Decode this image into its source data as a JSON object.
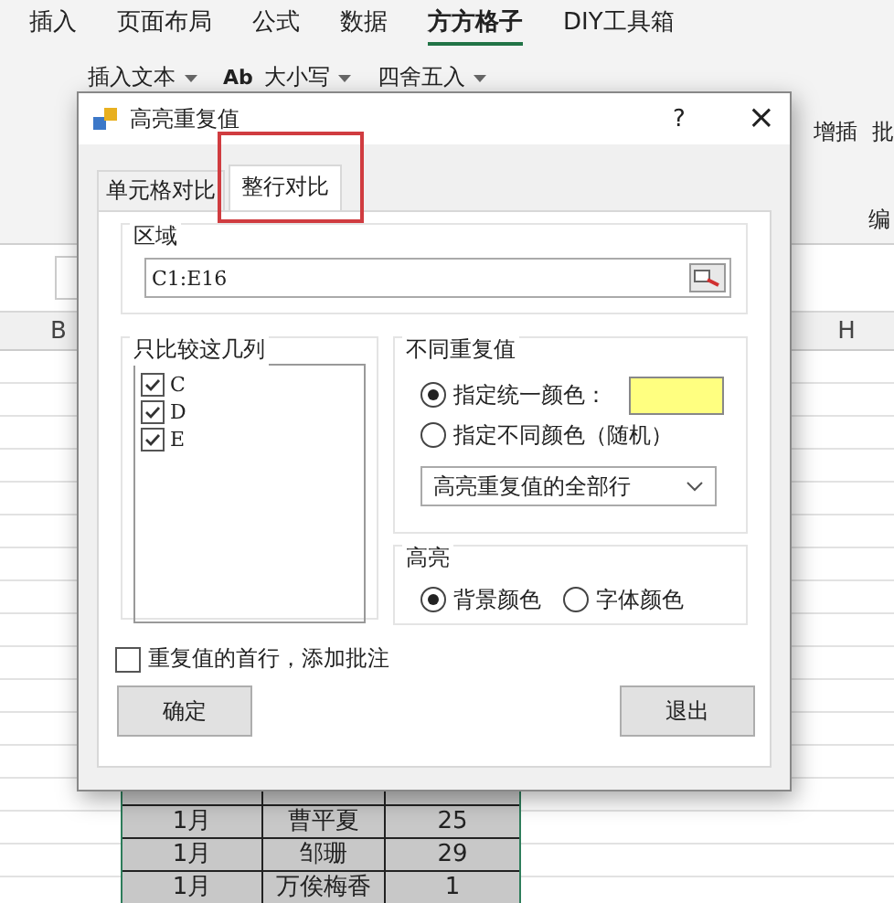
{
  "ribbon_tabs": [
    {
      "label": "插入",
      "selected": false
    },
    {
      "label": "页面布局",
      "selected": false
    },
    {
      "label": "公式",
      "selected": false
    },
    {
      "label": "数据",
      "selected": false
    },
    {
      "label": "方方格子",
      "selected": true
    },
    {
      "label": "DIY工具箱",
      "selected": false
    }
  ],
  "ribbon_buttons": [
    {
      "kind": "dropdown",
      "label": "插入文本"
    },
    {
      "kind": "dropdown",
      "glyph": "Ab",
      "label": "大小写"
    },
    {
      "kind": "dropdown",
      "label": "四舍五入"
    }
  ],
  "ribbon_right": [
    {
      "label": "增插"
    },
    {
      "label": "批"
    }
  ],
  "ribbon_group_label": "编",
  "column_headers": [
    "B",
    "H"
  ],
  "sheet_rows": [
    [
      "1月",
      "曹平夏",
      "25"
    ],
    [
      "1月",
      "邹珊",
      "29"
    ],
    [
      "1月",
      "万俟梅香",
      "1"
    ]
  ],
  "dialog": {
    "title": "高亮重复值",
    "help": "?",
    "close": "×",
    "tabs": [
      {
        "label": "单元格对比",
        "selected": false
      },
      {
        "label": "整行对比",
        "selected": true,
        "highlighted": true
      }
    ],
    "range_group": {
      "title": "区域",
      "value": "C1:E16"
    },
    "columns_group": {
      "title": "只比较这几列",
      "items": [
        {
          "label": "C",
          "checked": true
        },
        {
          "label": "D",
          "checked": true
        },
        {
          "label": "E",
          "checked": true
        }
      ]
    },
    "duplicate_group": {
      "title": "不同重复值",
      "options": [
        {
          "label": "指定统一颜色：",
          "selected": true,
          "color": "#ffff80"
        },
        {
          "label": "指定不同颜色（随机）",
          "selected": false
        }
      ],
      "mode": "高亮重复值的全部行"
    },
    "highlight_group": {
      "title": "高亮",
      "options": [
        {
          "label": "背景颜色",
          "selected": true
        },
        {
          "label": "字体颜色",
          "selected": false
        }
      ]
    },
    "comment_option": {
      "label": "重复值的首行，添加批注",
      "checked": false
    },
    "buttons": [
      "确定",
      "退出"
    ]
  }
}
